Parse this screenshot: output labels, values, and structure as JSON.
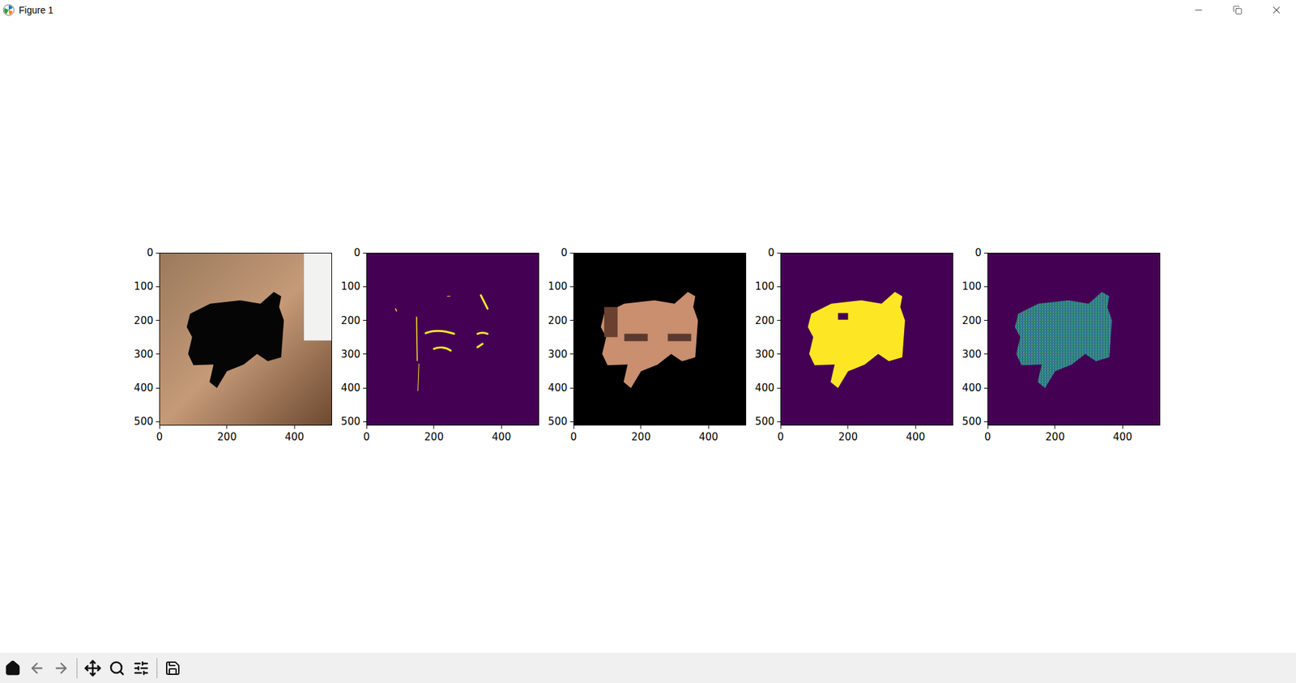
{
  "window": {
    "title": "Figure 1"
  },
  "subplots": [
    {
      "kind": "photo",
      "xticks": [
        "0",
        "200",
        "400"
      ],
      "yticks": [
        "0",
        "100",
        "200",
        "300",
        "400",
        "500"
      ]
    },
    {
      "kind": "edges",
      "xticks": [
        "0",
        "200",
        "400"
      ],
      "yticks": [
        "0",
        "100",
        "200",
        "300",
        "400",
        "500"
      ]
    },
    {
      "kind": "crop",
      "xticks": [
        "0",
        "200",
        "400"
      ],
      "yticks": [
        "0",
        "100",
        "200",
        "300",
        "400",
        "500"
      ]
    },
    {
      "kind": "mask",
      "xticks": [
        "0",
        "200",
        "400"
      ],
      "yticks": [
        "0",
        "100",
        "200",
        "300",
        "400",
        "500"
      ]
    },
    {
      "kind": "noise",
      "xticks": [
        "0",
        "200",
        "400"
      ],
      "yticks": [
        "0",
        "100",
        "200",
        "300",
        "400",
        "500"
      ]
    }
  ]
}
